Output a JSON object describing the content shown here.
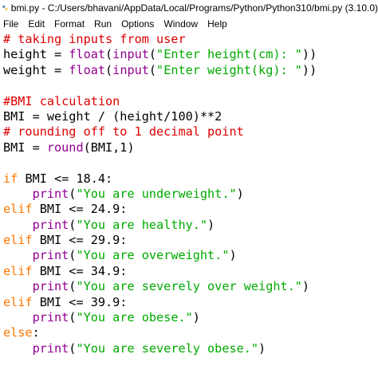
{
  "window": {
    "title": "bmi.py - C:/Users/bhavani/AppData/Local/Programs/Python/Python310/bmi.py (3.10.0)"
  },
  "menu": {
    "items": [
      "File",
      "Edit",
      "Format",
      "Run",
      "Options",
      "Window",
      "Help"
    ]
  },
  "colors": {
    "comment": "#dd0000",
    "keyword": "#ff7700",
    "builtin": "#900090",
    "string": "#00aa00",
    "default": "#000000"
  },
  "code": {
    "lines": [
      [
        {
          "t": "comment",
          "v": "# taking inputs from user"
        }
      ],
      [
        {
          "t": "plain",
          "v": "height = "
        },
        {
          "t": "builtin",
          "v": "float"
        },
        {
          "t": "plain",
          "v": "("
        },
        {
          "t": "builtin",
          "v": "input"
        },
        {
          "t": "plain",
          "v": "("
        },
        {
          "t": "string",
          "v": "\"Enter height(cm): \""
        },
        {
          "t": "plain",
          "v": "))"
        }
      ],
      [
        {
          "t": "plain",
          "v": "weight = "
        },
        {
          "t": "builtin",
          "v": "float"
        },
        {
          "t": "plain",
          "v": "("
        },
        {
          "t": "builtin",
          "v": "input"
        },
        {
          "t": "plain",
          "v": "("
        },
        {
          "t": "string",
          "v": "\"Enter weight(kg): \""
        },
        {
          "t": "plain",
          "v": "))"
        }
      ],
      [],
      [
        {
          "t": "comment",
          "v": "#BMI calculation"
        }
      ],
      [
        {
          "t": "plain",
          "v": "BMI = weight / (height/100)**2"
        }
      ],
      [
        {
          "t": "comment",
          "v": "# rounding off to 1 decimal point"
        }
      ],
      [
        {
          "t": "plain",
          "v": "BMI = "
        },
        {
          "t": "builtin",
          "v": "round"
        },
        {
          "t": "plain",
          "v": "(BMI,1)"
        }
      ],
      [],
      [
        {
          "t": "keyword",
          "v": "if"
        },
        {
          "t": "plain",
          "v": " BMI <= 18.4:"
        }
      ],
      [
        {
          "t": "plain",
          "v": "    "
        },
        {
          "t": "builtin",
          "v": "print"
        },
        {
          "t": "plain",
          "v": "("
        },
        {
          "t": "string",
          "v": "\"You are underweight.\""
        },
        {
          "t": "plain",
          "v": ")"
        }
      ],
      [
        {
          "t": "keyword",
          "v": "elif"
        },
        {
          "t": "plain",
          "v": " BMI <= 24.9:"
        }
      ],
      [
        {
          "t": "plain",
          "v": "    "
        },
        {
          "t": "builtin",
          "v": "print"
        },
        {
          "t": "plain",
          "v": "("
        },
        {
          "t": "string",
          "v": "\"You are healthy.\""
        },
        {
          "t": "plain",
          "v": ")"
        }
      ],
      [
        {
          "t": "keyword",
          "v": "elif"
        },
        {
          "t": "plain",
          "v": " BMI <= 29.9:"
        }
      ],
      [
        {
          "t": "plain",
          "v": "    "
        },
        {
          "t": "builtin",
          "v": "print"
        },
        {
          "t": "plain",
          "v": "("
        },
        {
          "t": "string",
          "v": "\"You are overweight.\""
        },
        {
          "t": "plain",
          "v": ")"
        }
      ],
      [
        {
          "t": "keyword",
          "v": "elif"
        },
        {
          "t": "plain",
          "v": " BMI <= 34.9:"
        }
      ],
      [
        {
          "t": "plain",
          "v": "    "
        },
        {
          "t": "builtin",
          "v": "print"
        },
        {
          "t": "plain",
          "v": "("
        },
        {
          "t": "string",
          "v": "\"You are severely over weight.\""
        },
        {
          "t": "plain",
          "v": ")"
        }
      ],
      [
        {
          "t": "keyword",
          "v": "elif"
        },
        {
          "t": "plain",
          "v": " BMI <= 39.9:"
        }
      ],
      [
        {
          "t": "plain",
          "v": "    "
        },
        {
          "t": "builtin",
          "v": "print"
        },
        {
          "t": "plain",
          "v": "("
        },
        {
          "t": "string",
          "v": "\"You are obese.\""
        },
        {
          "t": "plain",
          "v": ")"
        }
      ],
      [
        {
          "t": "keyword",
          "v": "else"
        },
        {
          "t": "plain",
          "v": ":"
        }
      ],
      [
        {
          "t": "plain",
          "v": "    "
        },
        {
          "t": "builtin",
          "v": "print"
        },
        {
          "t": "plain",
          "v": "("
        },
        {
          "t": "string",
          "v": "\"You are severely obese.\""
        },
        {
          "t": "plain",
          "v": ")"
        }
      ]
    ]
  }
}
